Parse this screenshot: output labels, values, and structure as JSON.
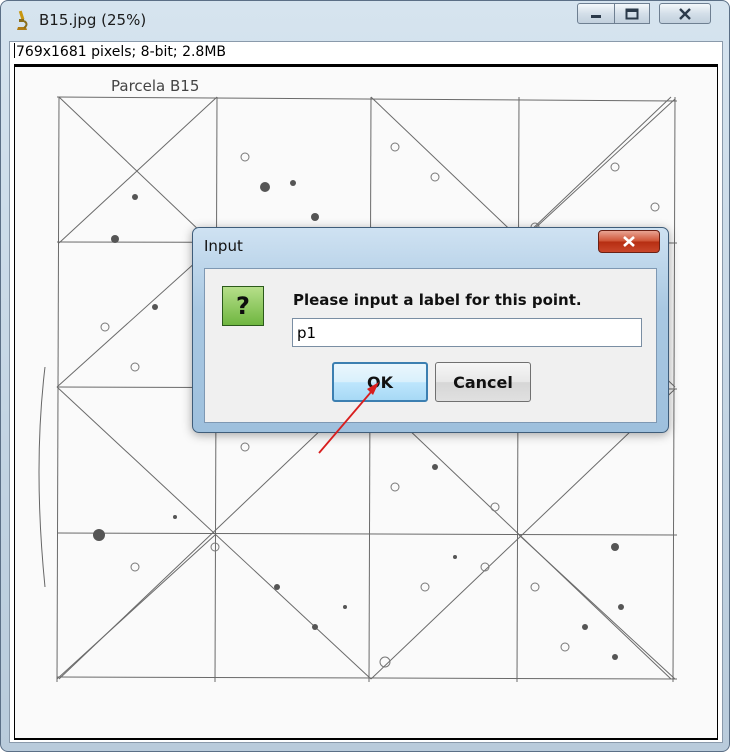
{
  "window": {
    "title": "B15.jpg (25%)",
    "info_bar": "769x1681 pixels; 8-bit; 2.8MB"
  },
  "image": {
    "heading": "Parcela  B15"
  },
  "dialog": {
    "title": "Input",
    "prompt": "Please input a label for this point.",
    "input_value": "p1",
    "ok_label": "OK",
    "cancel_label": "Cancel",
    "icon": "question-icon",
    "icon_glyph": "?"
  },
  "colors": {
    "accent": "#3c7fb1",
    "close_red": "#c9462a",
    "icon_green": "#6fb640",
    "arrow_red": "#d81e1e"
  }
}
